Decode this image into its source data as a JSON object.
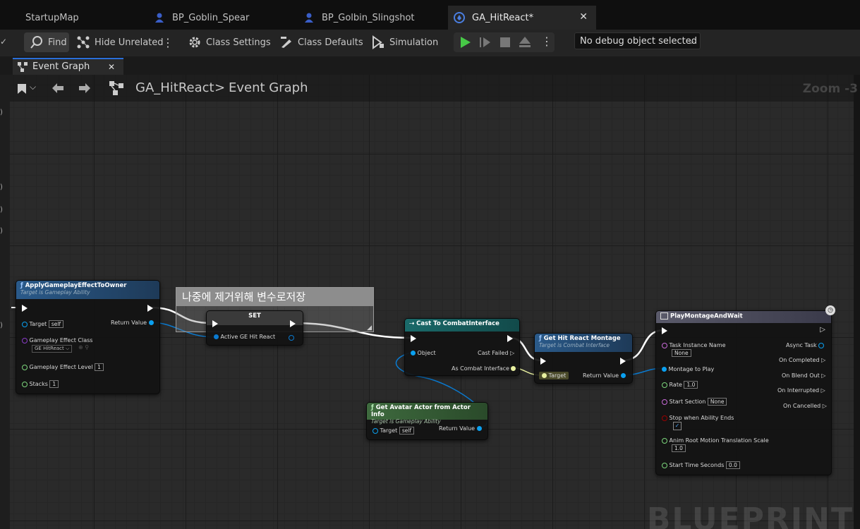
{
  "tabs": [
    {
      "label": "StartupMap",
      "icon": "map-icon"
    },
    {
      "label": "BP_Goblin_Spear",
      "icon": "blueprint-character-icon"
    },
    {
      "label": "BP_Golbin_Slingshot",
      "icon": "blueprint-character-icon"
    },
    {
      "label": "GA_HitReact*",
      "icon": "blueprint-ability-icon"
    }
  ],
  "toolbar": {
    "find": "Find",
    "hide_unrelated": "Hide Unrelated",
    "class_settings": "Class Settings",
    "class_defaults": "Class Defaults",
    "simulation": "Simulation",
    "debug_object": "No debug object selected"
  },
  "graph_tab": {
    "label": "Event Graph"
  },
  "breadcrumb": {
    "root": "GA_HitReact",
    "separator": ">",
    "current": "Event Graph",
    "zoom": "Zoom -3"
  },
  "comment": {
    "text": "나중에 제거위해 변수로저장"
  },
  "nodes": {
    "apply_effect": {
      "title": "ApplyGameplayEffectToOwner",
      "subtitle": "Target is Gameplay Ability",
      "target_label": "Target",
      "target_value": "self",
      "return_label": "Return Value",
      "class_label": "Gameplay Effect Class",
      "class_value": "GE HitReact",
      "level_label": "Gameplay Effect Level",
      "level_value": "1",
      "stacks_label": "Stacks",
      "stacks_value": "1"
    },
    "set": {
      "title": "SET",
      "var_label": "Active GE Hit React"
    },
    "cast": {
      "title": "Cast To CombatInterface",
      "object_label": "Object",
      "cast_failed": "Cast Failed",
      "as_label": "As Combat Interface"
    },
    "get_montage": {
      "title": "Get Hit React Montage",
      "subtitle": "Target is Combat Interface",
      "target_label": "Target",
      "return_label": "Return Value"
    },
    "avatar": {
      "title": "Get Avatar Actor from Actor Info",
      "subtitle": "Target is Gameplay Ability",
      "target_label": "Target",
      "target_value": "self",
      "return_label": "Return Value"
    },
    "play_montage": {
      "title": "PlayMontageAndWait",
      "task_label": "Task Instance Name",
      "task_value": "None",
      "async_label": "Async Task",
      "on_completed": "On Completed",
      "on_blend_out": "On Blend Out",
      "on_interrupted": "On Interrupted",
      "on_cancelled": "On Cancelled",
      "montage_label": "Montage to Play",
      "rate_label": "Rate",
      "rate_value": "1.0",
      "section_label": "Start Section",
      "section_value": "None",
      "stop_label": "Stop when Ability Ends",
      "root_label": "Anim Root Motion Translation Scale",
      "root_value": "1.0",
      "start_time_label": "Start Time Seconds",
      "start_time_value": "0.0"
    }
  },
  "watermark": "BLUEPRINT",
  "colors": {
    "exec": "#ffffff",
    "object": "#0aa0f0",
    "interface": "#e8f0a0",
    "float": "#7cd67c",
    "class": "#8a3cc8",
    "bool": "#9a0000"
  }
}
